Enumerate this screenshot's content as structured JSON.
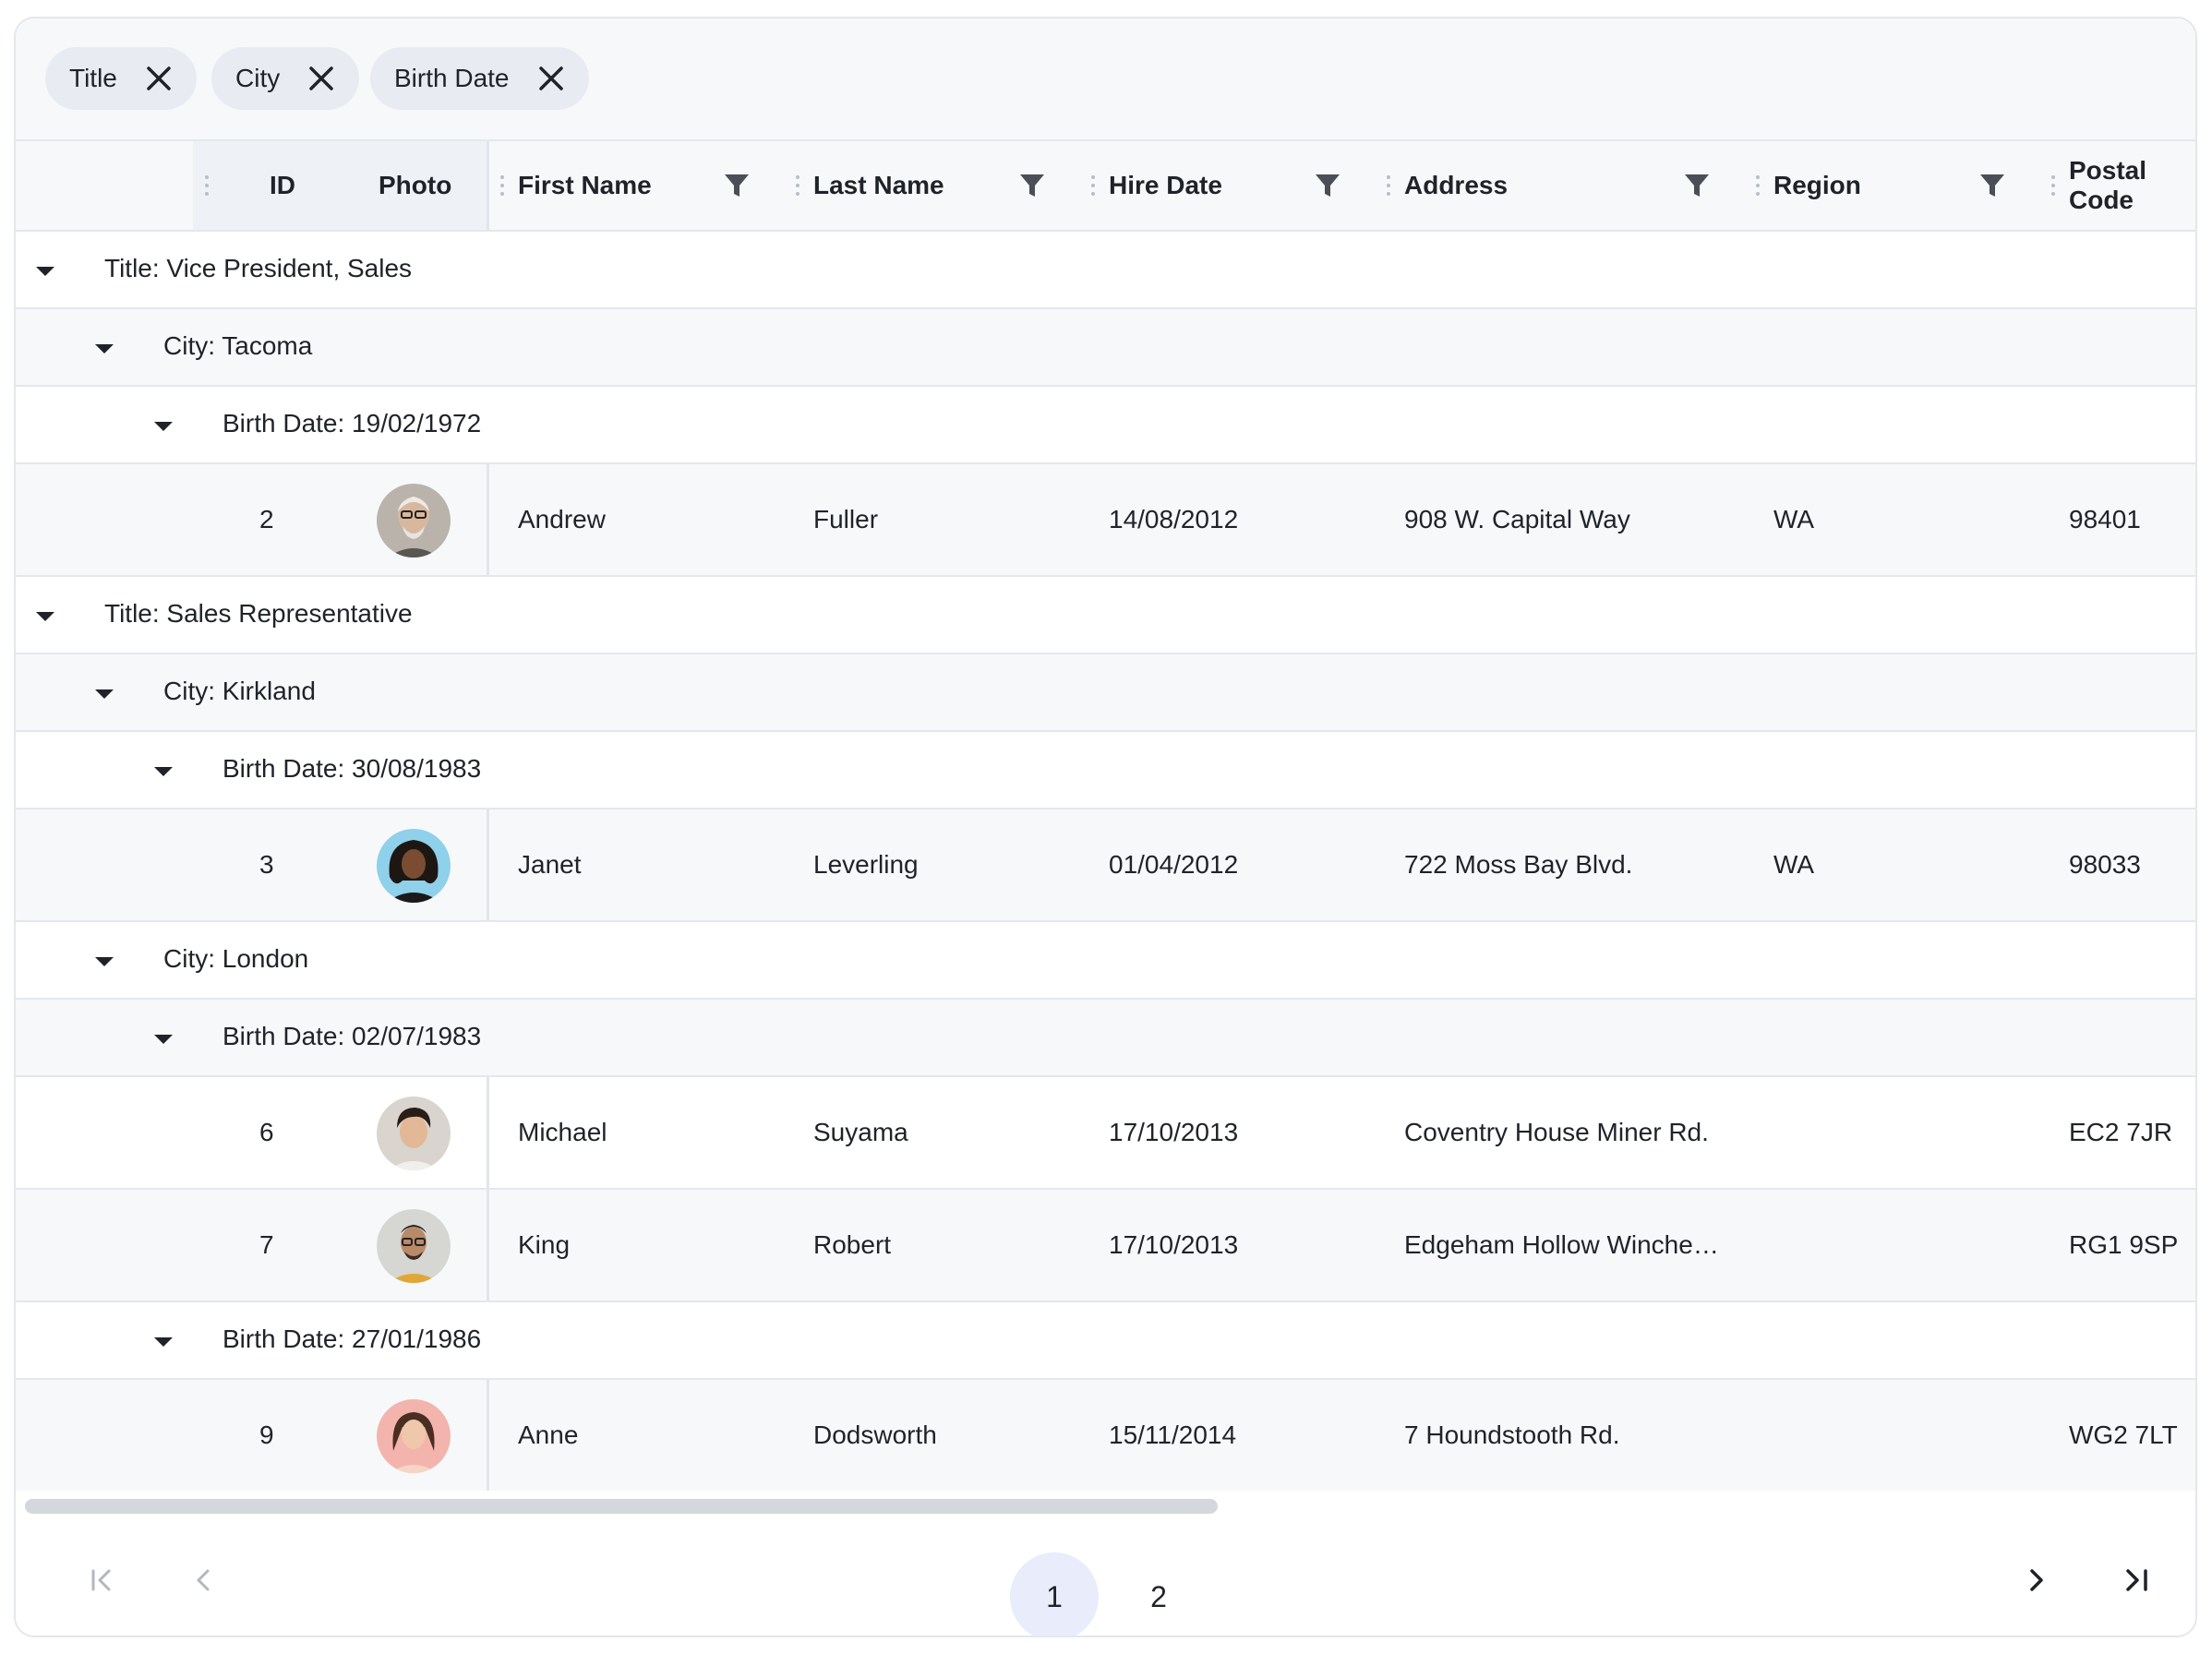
{
  "group_chips": [
    {
      "label": "Title"
    },
    {
      "label": "City"
    },
    {
      "label": "Birth Date"
    }
  ],
  "columns": {
    "id": "ID",
    "photo": "Photo",
    "first_name": "First Name",
    "last_name": "Last Name",
    "hire_date": "Hire Date",
    "address": "Address",
    "region": "Region",
    "postal_code": "Postal Code"
  },
  "groups": {
    "g1": "Title: Vice President, Sales",
    "g1_city": "City: Tacoma",
    "g1_birth": "Birth Date: 19/02/1972",
    "g2": "Title: Sales Representative",
    "g2_city1": "City: Kirkland",
    "g2_city1_birth": "Birth Date: 30/08/1983",
    "g2_city2": "City: London",
    "g2_city2_birth1": "Birth Date: 02/07/1983",
    "g2_city2_birth2": "Birth Date: 27/01/1986"
  },
  "rows": [
    {
      "id": "2",
      "first_name": "Andrew",
      "last_name": "Fuller",
      "hire_date": "14/08/2012",
      "address": "908 W. Capital Way",
      "region": "WA",
      "postal_code": "98401"
    },
    {
      "id": "3",
      "first_name": "Janet",
      "last_name": "Leverling",
      "hire_date": "01/04/2012",
      "address": "722 Moss Bay Blvd.",
      "region": "WA",
      "postal_code": "98033"
    },
    {
      "id": "6",
      "first_name": "Michael",
      "last_name": "Suyama",
      "hire_date": "17/10/2013",
      "address": "Coventry House Miner Rd.",
      "region": "",
      "postal_code": "EC2 7JR"
    },
    {
      "id": "7",
      "first_name": "King",
      "last_name": "Robert",
      "hire_date": "17/10/2013",
      "address": "Edgeham Hollow Winche…",
      "region": "",
      "postal_code": "RG1 9SP"
    },
    {
      "id": "9",
      "first_name": "Anne",
      "last_name": "Dodsworth",
      "hire_date": "15/11/2014",
      "address": "7 Houndstooth Rd.",
      "region": "",
      "postal_code": "WG2 7LT"
    }
  ],
  "pager": {
    "pages": [
      "1",
      "2"
    ],
    "current_page": "1"
  },
  "colors": {
    "accent": "#e8ecfb",
    "header_bg": "#f7f8fa",
    "border": "#e4e7ec"
  },
  "icons": {
    "chip_remove": "close-icon",
    "column_filter": "filter-icon",
    "group_toggle": "caret-down-icon",
    "pager_first": "first-page-icon",
    "pager_prev": "chevron-left-icon",
    "pager_next": "chevron-right-icon",
    "pager_last": "last-page-icon"
  }
}
